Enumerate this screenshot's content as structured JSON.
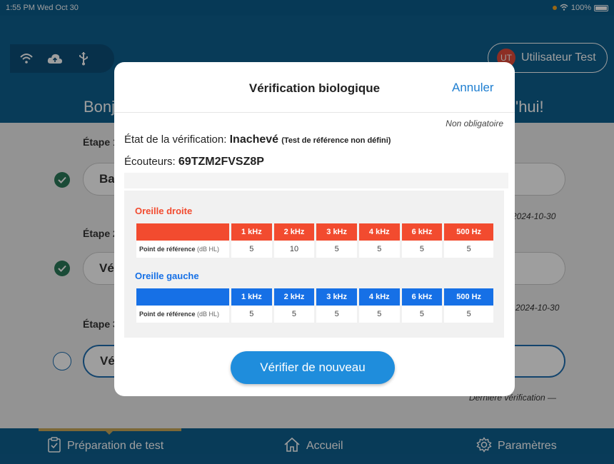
{
  "status_bar": {
    "time": "1:55 PM",
    "date": "Wed Oct 30",
    "battery": "100%"
  },
  "header": {
    "user_initials": "UT",
    "user_name": "Utilisateur Test",
    "greeting_left": "Bonj",
    "greeting_right": "'hui!",
    "icons": [
      "wifi-icon",
      "cloud-upload-icon",
      "usb-icon"
    ]
  },
  "steps": [
    {
      "label": "Étape 1",
      "button": "Ba",
      "status": "complete",
      "date": "e 2024-10-30"
    },
    {
      "label": "Étape 2",
      "button": "Vé",
      "status": "complete",
      "date": "n 2024-10-30"
    },
    {
      "label": "Étape 3",
      "button": "Vé",
      "status": "pending",
      "date": "Dernière vérification —"
    }
  ],
  "modal": {
    "title": "Vérification biologique",
    "cancel": "Annuler",
    "optional": "Non obligatoire",
    "status_label": "État de la vérification:",
    "status_value": "Inachevé",
    "status_note": "(Test de référence non défini)",
    "headphones_label": "Écouteurs:",
    "headphones_value": "69TZM2FVSZ8P",
    "verify_button": "Vérifier de nouveau",
    "colors": {
      "right_ear": "#f24b2f",
      "left_ear": "#1670e6",
      "accent": "#1f8ddc"
    },
    "right_ear": {
      "title": "Oreille droite",
      "frequencies": [
        "1 kHz",
        "2 kHz",
        "3 kHz",
        "4 kHz",
        "6 kHz",
        "500 Hz"
      ],
      "row_label": "Point de référence",
      "row_unit": "(dB HL)",
      "values": [
        "5",
        "10",
        "5",
        "5",
        "5",
        "5"
      ]
    },
    "left_ear": {
      "title": "Oreille gauche",
      "frequencies": [
        "1 kHz",
        "2 kHz",
        "3 kHz",
        "4 kHz",
        "6 kHz",
        "500 Hz"
      ],
      "row_label": "Point de référence",
      "row_unit": "(dB HL)",
      "values": [
        "5",
        "5",
        "5",
        "5",
        "5",
        "5"
      ]
    }
  },
  "bottom_nav": {
    "prep": "Préparation de test",
    "home": "Accueil",
    "settings": "Paramètres"
  }
}
